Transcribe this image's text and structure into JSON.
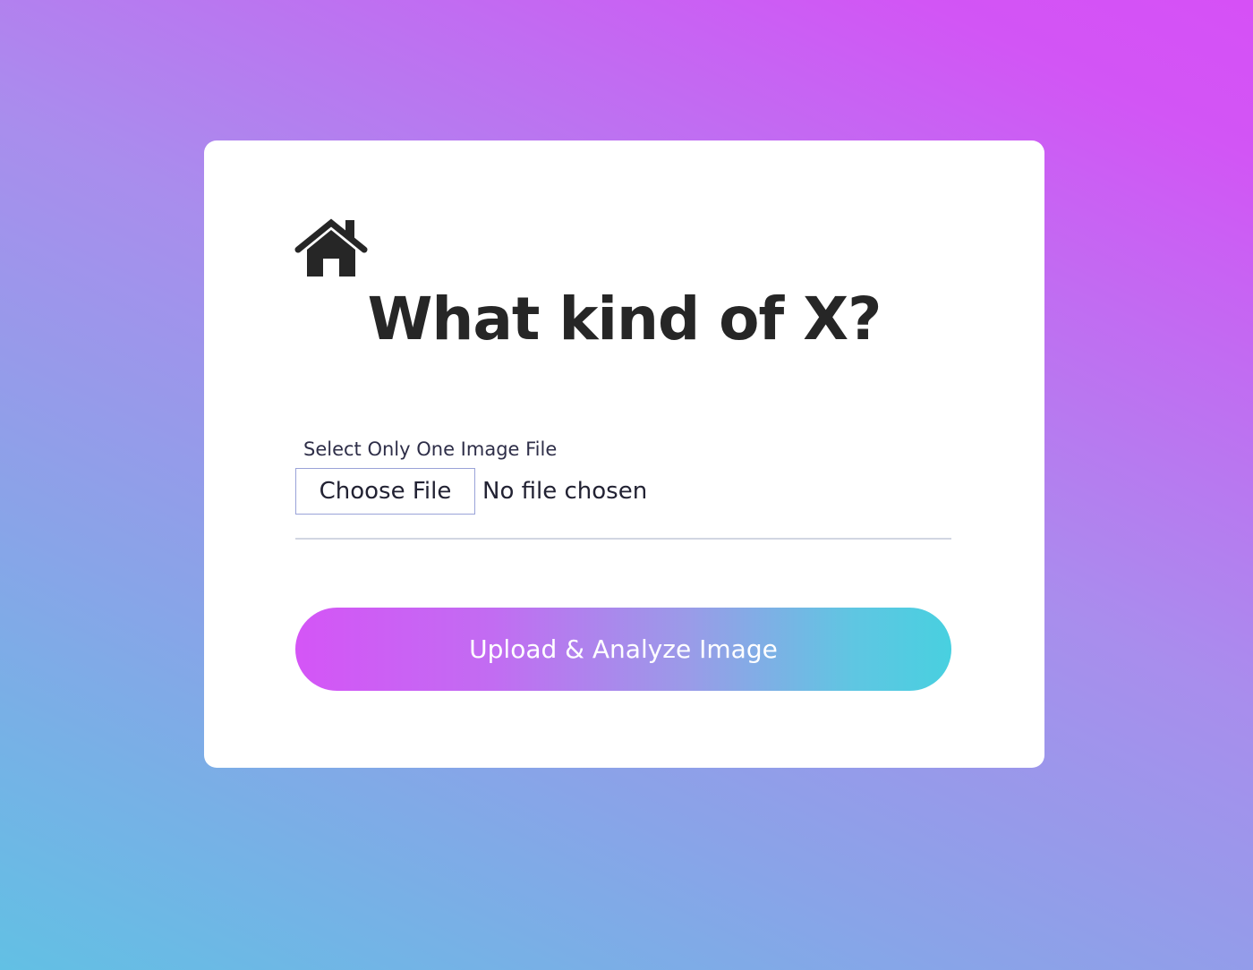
{
  "header": {
    "home_icon": "home-icon",
    "title": "What kind of X?"
  },
  "form": {
    "file_label": "Select Only One Image File",
    "choose_button_label": "Choose File",
    "file_status": "No file chosen",
    "submit_label": "Upload & Analyze Image"
  },
  "colors": {
    "background_gradient": [
      "#62c0e4",
      "#d650f6"
    ],
    "button_gradient": [
      "#d455f6",
      "#48d0e0"
    ],
    "title_color": "#262626"
  }
}
